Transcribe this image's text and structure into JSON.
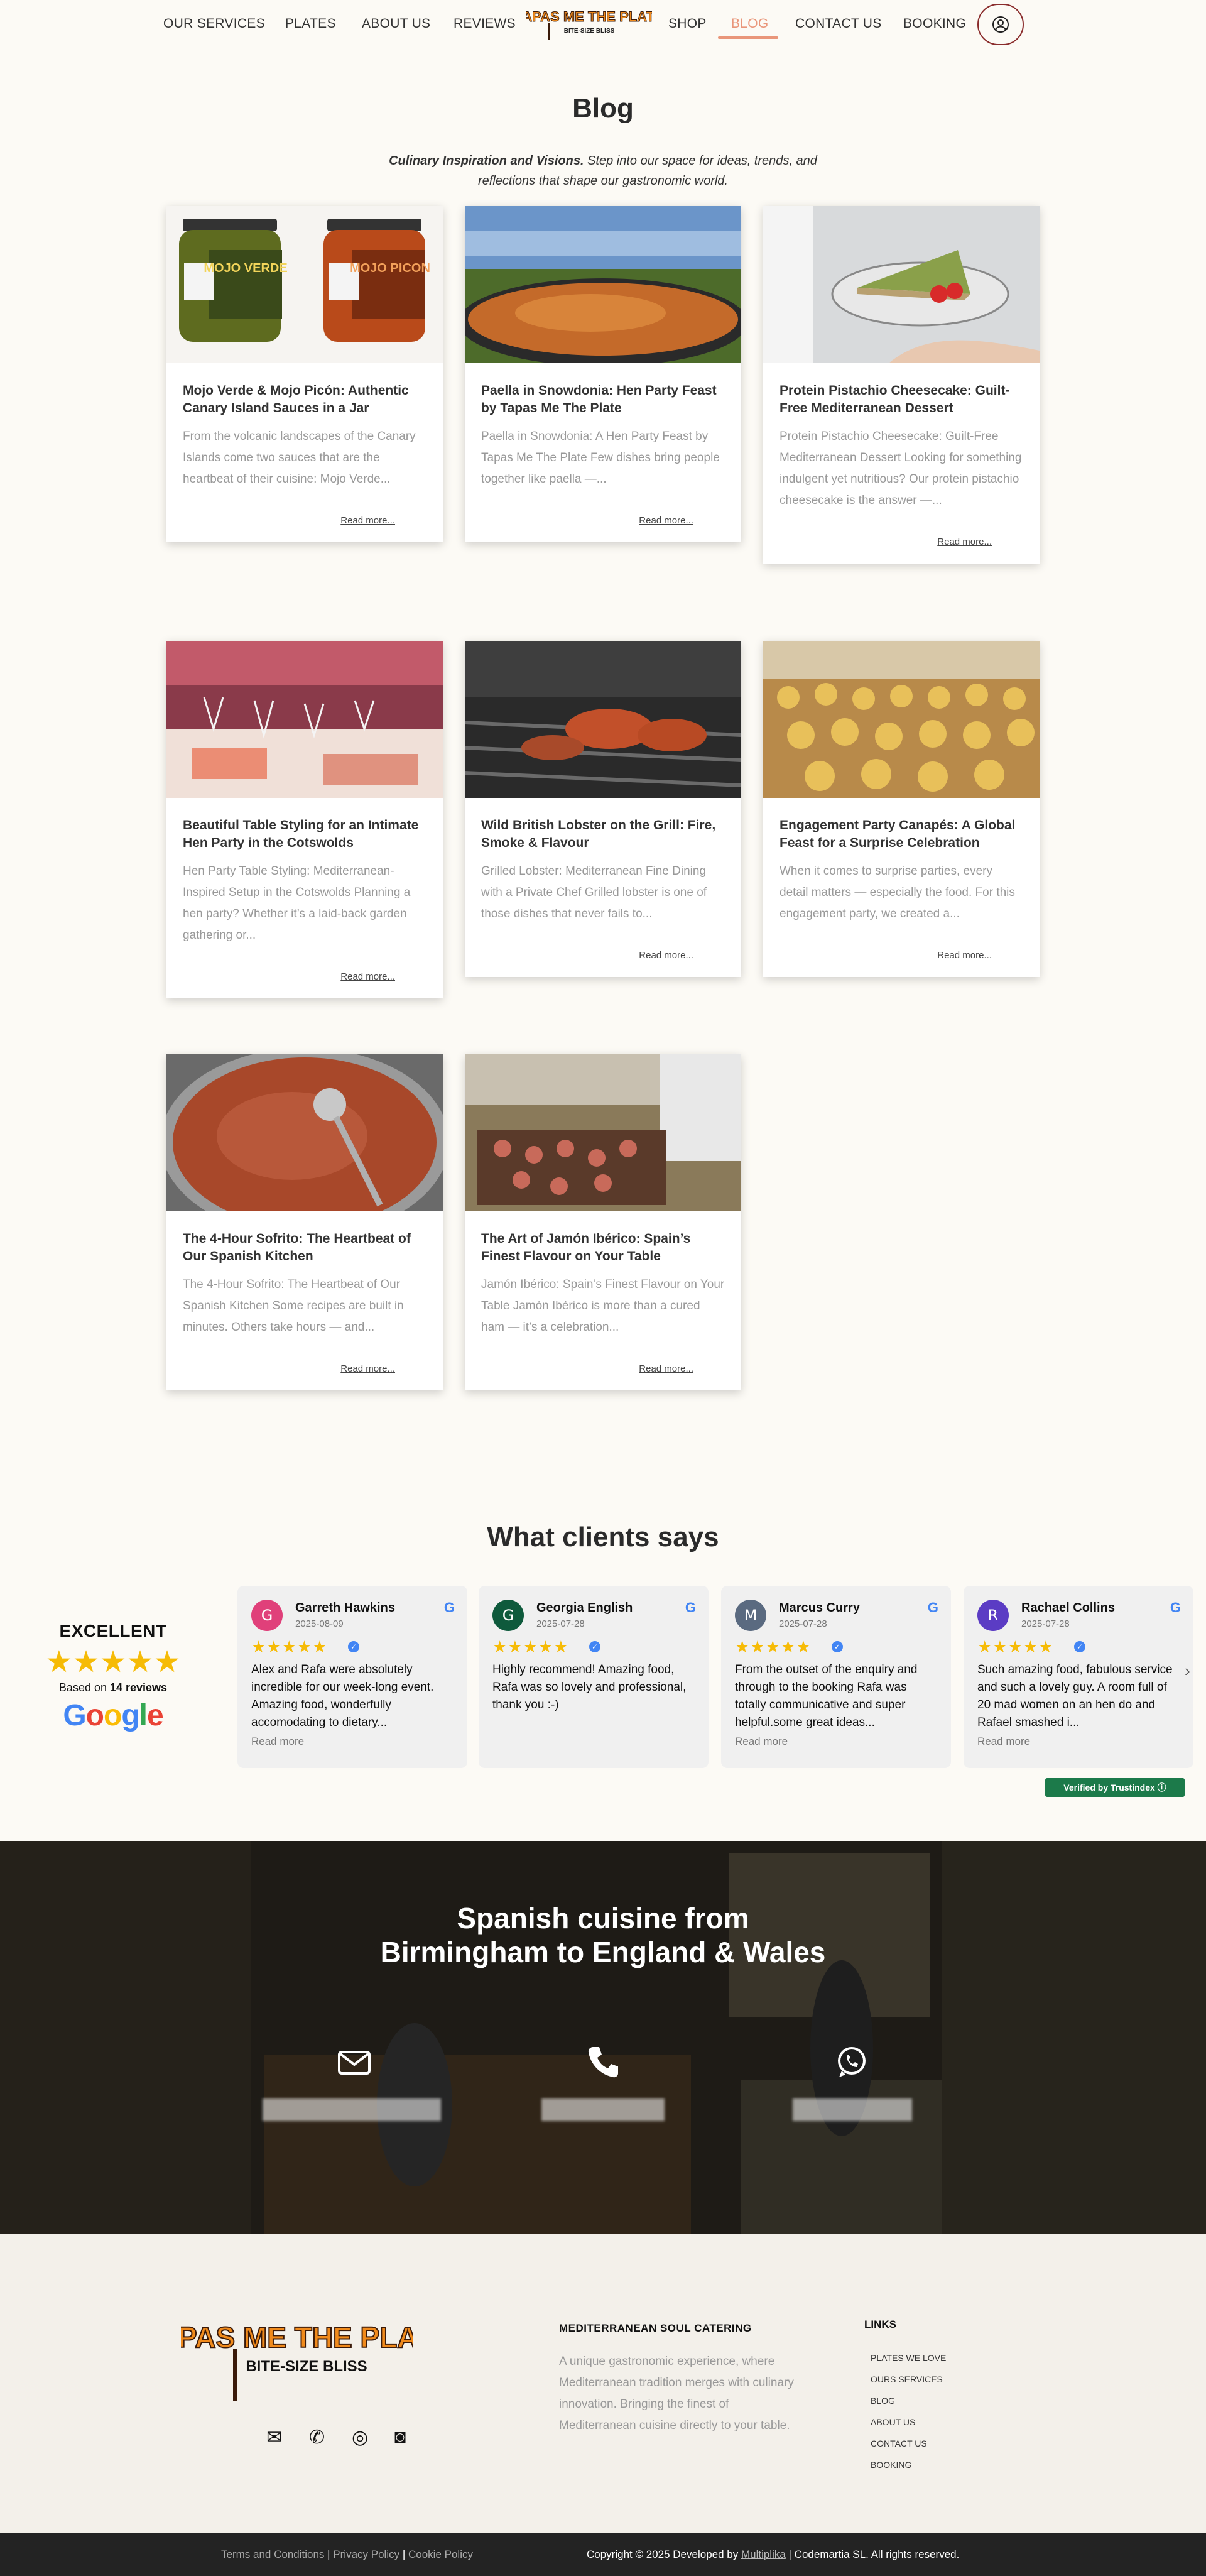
{
  "nav": {
    "items_left": [
      {
        "label": "OUR SERVICES"
      },
      {
        "label": "PLATES"
      },
      {
        "label": "ABOUT US"
      },
      {
        "label": "REVIEWS"
      }
    ],
    "logo_text": "TAPAS ME THE PLATE",
    "logo_tagline": "BITE-SIZE BLISS",
    "items_right": [
      {
        "label": "SHOP"
      },
      {
        "label": "BLOG"
      },
      {
        "label": "CONTACT US"
      },
      {
        "label": "BOOKING"
      }
    ],
    "active_color": "#e9967a"
  },
  "blog": {
    "title": "Blog",
    "intro_bold": "Culinary Inspiration and Visions.",
    "intro_rest": " Step into our space for ideas, trends, and reflections that shape our gastronomic world.",
    "read_more": "Read more...",
    "posts": [
      {
        "title": "Mojo Verde & Mojo Picón: Authentic Canary Island Sauces in a Jar",
        "excerpt": "From the volcanic landscapes of the Canary Islands come two sauces that are the heartbeat of their cuisine: Mojo Verde...",
        "jar_left": "MOJO VERDE",
        "jar_right": "MOJO PICON"
      },
      {
        "title": "Paella in Snowdonia: Hen Party Feast by Tapas Me The Plate",
        "excerpt": "Paella in Snowdonia: A Hen Party Feast by Tapas Me The Plate Few dishes bring people together like paella —..."
      },
      {
        "title": "Protein Pistachio Cheesecake: Guilt-Free Mediterranean Dessert",
        "excerpt": "Protein Pistachio Cheesecake: Guilt-Free Mediterranean Dessert Looking for something indulgent yet nutritious? Our protein pistachio cheesecake is the answer —..."
      },
      {
        "title": "Beautiful Table Styling for an Intimate Hen Party in the Cotswolds",
        "excerpt": "Hen Party Table Styling: Mediterranean-Inspired Setup in the Cotswolds Planning a hen party? Whether it’s a laid-back garden gathering or..."
      },
      {
        "title": "Wild British Lobster on the Grill: Fire, Smoke & Flavour",
        "excerpt": "Grilled Lobster: Mediterranean Fine Dining with a Private Chef Grilled lobster is one of those dishes that never fails to..."
      },
      {
        "title": "Engagement Party Canapés: A Global Feast for a Surprise Celebration",
        "excerpt": "When it comes to surprise parties, every detail matters — especially the food. For this engagement party, we created a..."
      },
      {
        "title": "The 4-Hour Sofrito: The Heartbeat of Our Spanish Kitchen",
        "excerpt": "The 4-Hour Sofrito: The Heartbeat of Our Spanish Kitchen Some recipes are built in minutes. Others take hours — and..."
      },
      {
        "title": "The Art of Jamón Ibérico: Spain’s Finest Flavour on Your Table",
        "excerpt": "Jamón Ibérico: Spain’s Finest Flavour on Your Table Jamón Ibérico is more than a cured ham — it’s a celebration..."
      }
    ]
  },
  "reviews": {
    "title": "What clients says",
    "summary_word": "EXCELLENT",
    "stars": "★★★★★",
    "based_on_prefix": "Based on ",
    "based_on_count": "14 reviews",
    "google_word": "Google",
    "read_more": "Read more",
    "next_icon": "chevron-right-icon",
    "items": [
      {
        "initial": "G",
        "name": "Garreth Hawkins",
        "date": "2025-08-09",
        "text": "Alex and Rafa were absolutely incredible for our week-long event. Amazing food, wonderfully accomodating to dietary...",
        "avatar_color": "#e0407a"
      },
      {
        "initial": "G",
        "name": "Georgia English",
        "date": "2025-07-28",
        "text": "Highly recommend! Amazing food, Rafa was so lovely and professional, thank you :-)",
        "avatar_color": "#0e5a3c"
      },
      {
        "initial": "M",
        "name": "Marcus Curry",
        "date": "2025-07-28",
        "text": "From the outset of the enquiry and through to the booking Rafa was totally communicative and super helpful.some great ideas...",
        "avatar_color": "#5a6a80"
      },
      {
        "initial": "R",
        "name": "Rachael Collins",
        "date": "2025-07-28",
        "text": "Such amazing food, fabulous service and such a lovely guy. A room full of 20 mad women on an hen do and Rafael smashed i...",
        "avatar_color": "#5b3cc4"
      }
    ],
    "verified": "Verified by Trustindex ⓘ"
  },
  "band": {
    "title_line1": "Spanish cuisine from",
    "title_line2": "Birmingham to England & Wales",
    "icons": [
      "email-icon",
      "phone-icon",
      "whatsapp-icon"
    ]
  },
  "footer": {
    "heading": "MEDITERRANEAN SOUL CATERING",
    "description": "A unique gastronomic experience, where Mediterranean tradition merges with culinary innovation. Bringing the finest of Mediterranean cuisine directly to your table.",
    "links_heading": "LINKS",
    "links": [
      "PLATES WE LOVE",
      "OURS SERVICES",
      "BLOG",
      "ABOUT US",
      "CONTACT US",
      "BOOKING"
    ],
    "social_icons": [
      "email-icon",
      "phone-icon",
      "whatsapp-icon",
      "instagram-icon"
    ],
    "bottom_terms": "Terms and Conditions",
    "bottom_privacy": "Privacy Policy",
    "bottom_cookie": "Cookie Policy",
    "copyright_prefix": "Copyright © 2025 Developed by ",
    "copyright_dev": "Multiplika",
    "copyright_suffix": " | Codemartia SL. All rights reserved."
  }
}
